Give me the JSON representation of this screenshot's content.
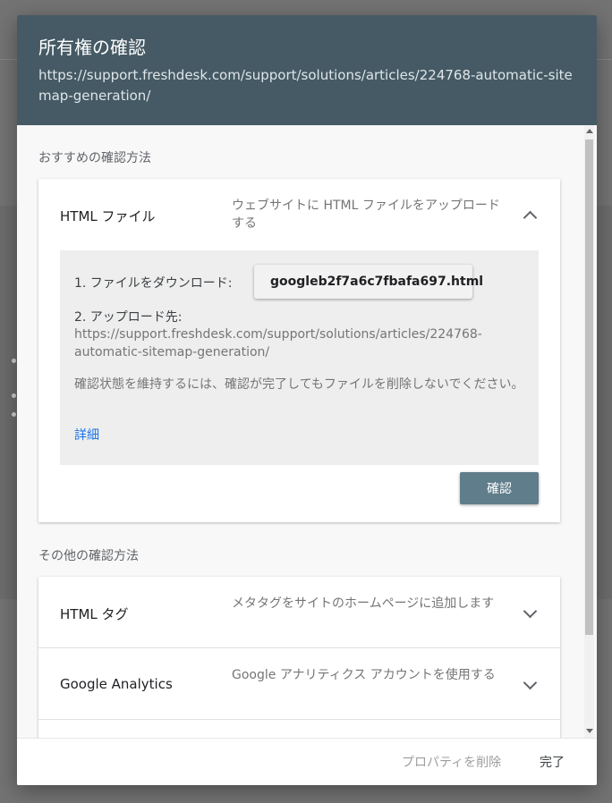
{
  "dialog": {
    "title": "所有権の確認",
    "url": "https://support.freshdesk.com/support/solutions/articles/224768-automatic-sitemap-generation/"
  },
  "recommended": {
    "label": "おすすめの確認方法",
    "method": {
      "title": "HTML ファイル",
      "description": "ウェブサイトに HTML ファイルをアップロードする",
      "expanded": true
    },
    "step1_label": "1. ファイルをダウンロード:",
    "download_file": "googleb2f7a6c7fbafa697.html",
    "step2_label": "2. アップロード先:",
    "upload_url": "https://support.freshdesk.com/support/solutions/articles/224768-automatic-sitemap-generation/",
    "note": "確認状態を維持するには、確認が完了してもファイルを削除しないでください。",
    "details_link": "詳細",
    "confirm_label": "確認"
  },
  "other": {
    "label": "その他の確認方法",
    "methods": [
      {
        "title": "HTML タグ",
        "description": "メタタグをサイトのホームページに追加します"
      },
      {
        "title": "Google Analytics",
        "description": "Google アナリティクス アカウントを使用する"
      }
    ]
  },
  "footer": {
    "delete_label": "プロパティを削除",
    "done_label": "完了"
  },
  "colors": {
    "header_bg": "#455a64",
    "confirm_bg": "#607d8b",
    "link": "#1a73e8"
  }
}
